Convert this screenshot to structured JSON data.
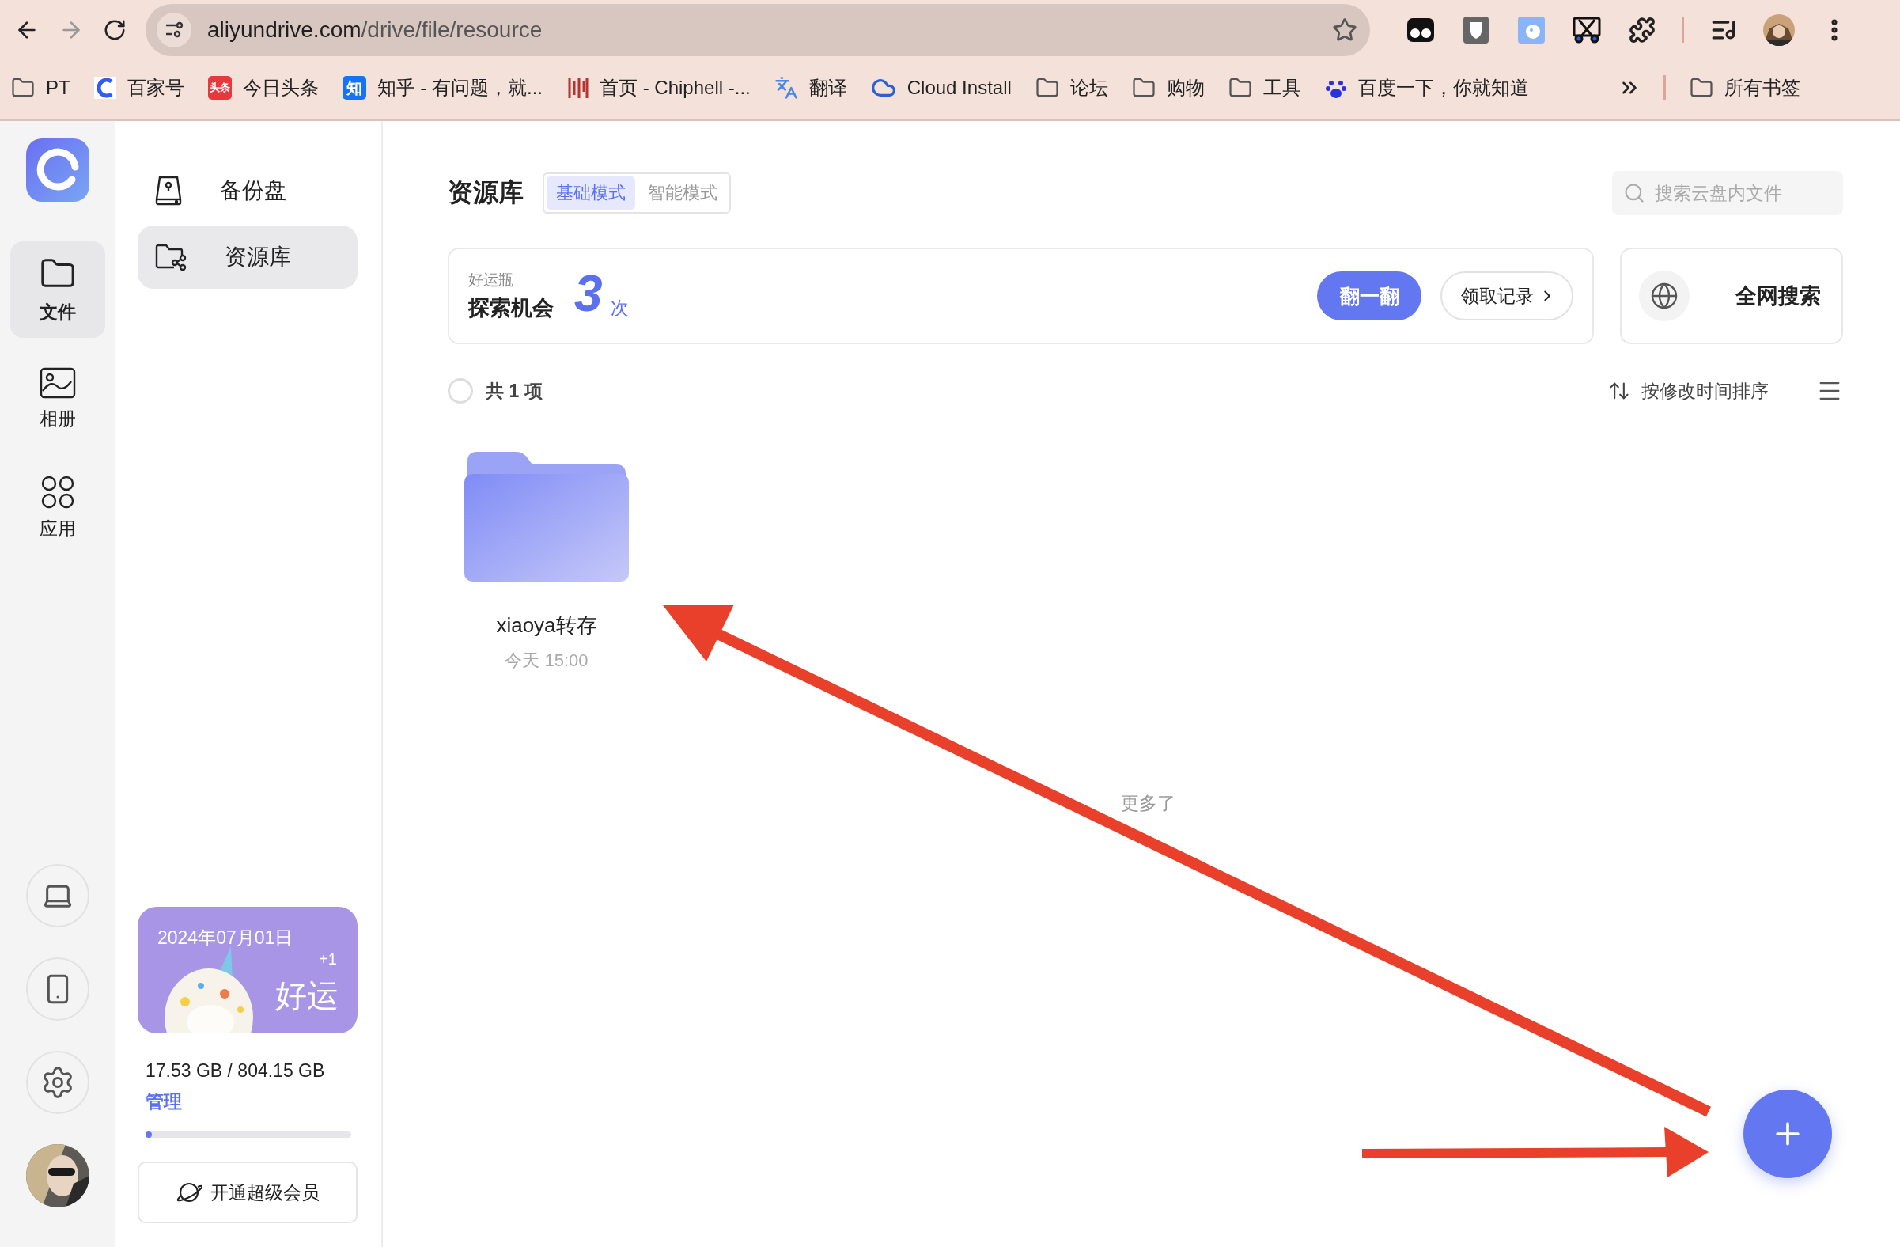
{
  "browser": {
    "url_host": "aliyundrive.com",
    "url_path": "/drive/file/resource",
    "bookmarks": [
      {
        "kind": "folder",
        "label": "PT"
      },
      {
        "kind": "baijia",
        "label": "百家号"
      },
      {
        "kind": "toutiao",
        "badge": "头条",
        "label": "今日头条"
      },
      {
        "kind": "zhihu",
        "badge": "知",
        "label": "知乎 - 有问题，就..."
      },
      {
        "kind": "chiphell",
        "label": "首页 - Chiphell -..."
      },
      {
        "kind": "translate",
        "label": "翻译"
      },
      {
        "kind": "cloud",
        "label": "Cloud Install"
      },
      {
        "kind": "folder",
        "label": "论坛"
      },
      {
        "kind": "folder",
        "label": "购物"
      },
      {
        "kind": "folder",
        "label": "工具"
      },
      {
        "kind": "baidu",
        "label": "百度一下，你就知道"
      }
    ],
    "all_bookmarks": "所有书签"
  },
  "rail": {
    "items": [
      {
        "kind": "files",
        "label": "文件",
        "selected": true
      },
      {
        "kind": "album",
        "label": "相册",
        "selected": false
      },
      {
        "kind": "apps",
        "label": "应用",
        "selected": false
      }
    ]
  },
  "sidebar": {
    "items": [
      {
        "kind": "backup",
        "label": "备份盘",
        "selected": false
      },
      {
        "kind": "library",
        "label": "资源库",
        "selected": true
      }
    ],
    "luck_card": {
      "date": "2024年07月01日",
      "bonus": "+1",
      "label": "好运"
    },
    "storage": {
      "usage": "17.53 GB / 804.15 GB",
      "manage": "管理",
      "level": 0.022
    },
    "vip_button": "开通超级会员"
  },
  "main": {
    "title": "资源库",
    "modes": [
      {
        "label": "基础模式",
        "selected": true
      },
      {
        "label": "智能模式",
        "selected": false
      }
    ],
    "search": {
      "placeholder": "搜索云盘内文件"
    },
    "lucky_bottle": {
      "caption": "好运瓶",
      "label": "探索机会",
      "count": "3",
      "unit": "次",
      "flip_button": "翻一翻",
      "history_button": "领取记录"
    },
    "web_search": "全网搜索",
    "select_all": {
      "label": "共 1 项",
      "checked": false
    },
    "sort": "按修改时间排序",
    "files": [
      {
        "name": "xiaoya转存",
        "time": "今天 15:00"
      }
    ],
    "end_note": "更多了"
  }
}
